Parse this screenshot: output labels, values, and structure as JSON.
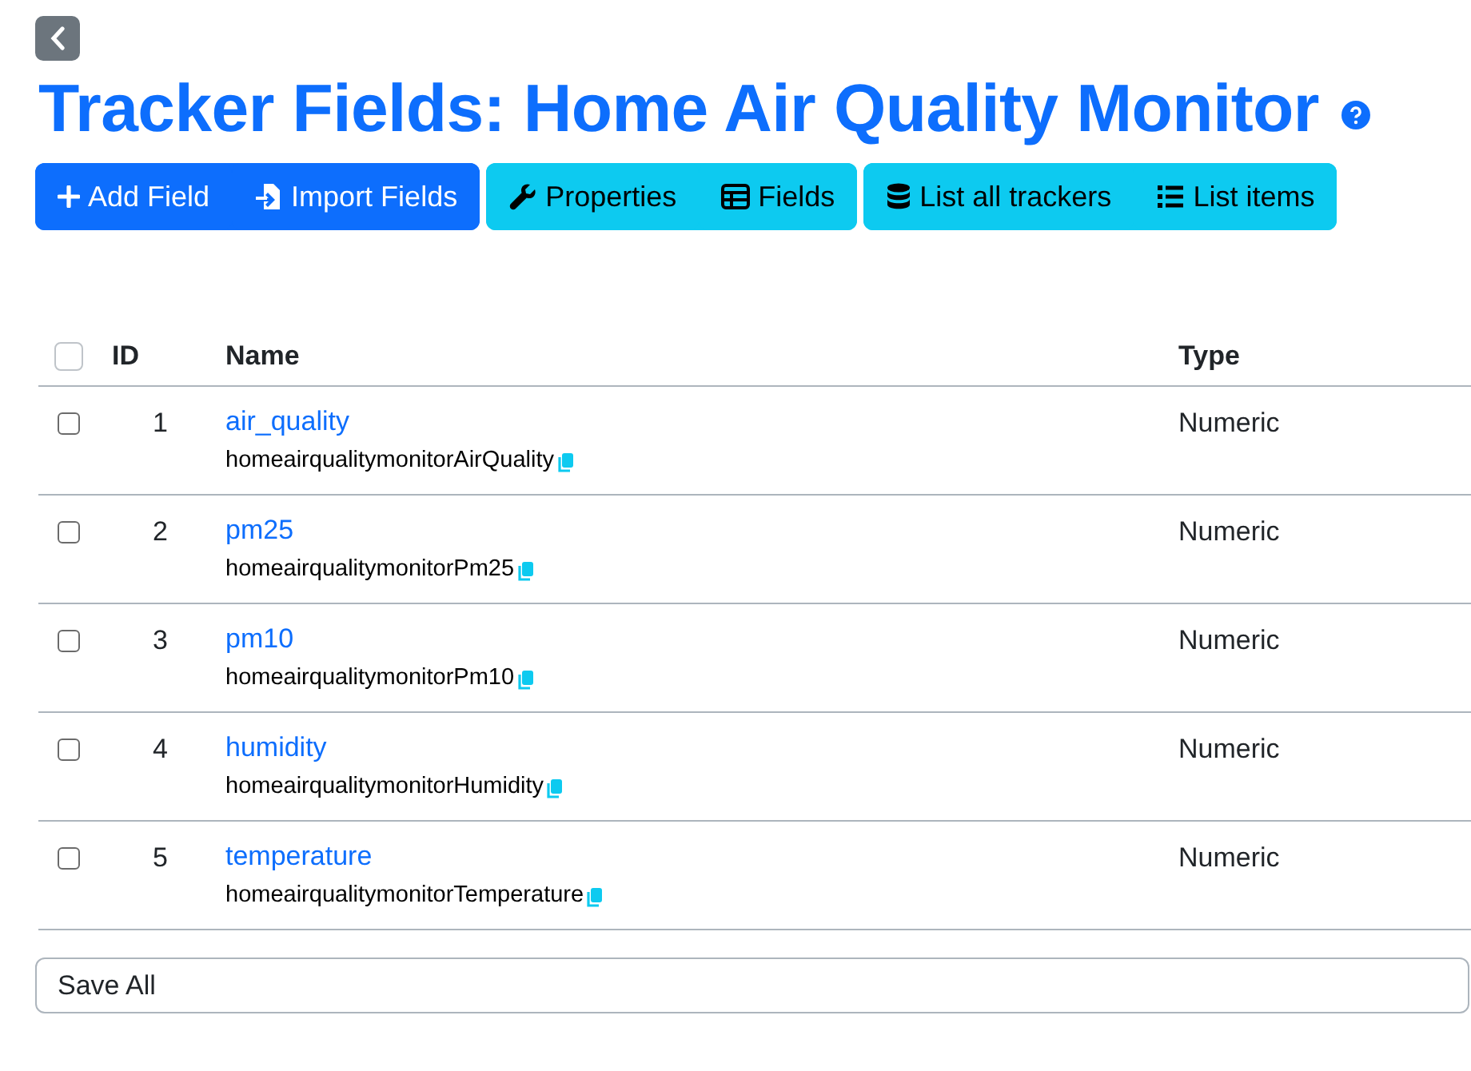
{
  "title": "Tracker Fields: Home Air Quality Monitor",
  "button_groups": [
    {
      "kind": "primary",
      "buttons": [
        "Add Field",
        "Import Fields"
      ]
    },
    {
      "kind": "info",
      "buttons": [
        "Properties",
        "Fields"
      ]
    },
    {
      "kind": "info",
      "buttons": [
        "List all trackers",
        "List items"
      ]
    }
  ],
  "table": {
    "select_all": {
      "checked": false
    },
    "columns": [
      "ID",
      "Name",
      "Type"
    ],
    "rows": [
      {
        "checked": false,
        "id": "1",
        "name": "air_quality",
        "key": "homeairqualitymonitorAirQuality",
        "type": "Numeric"
      },
      {
        "checked": false,
        "id": "2",
        "name": "pm25",
        "key": "homeairqualitymonitorPm25",
        "type": "Numeric"
      },
      {
        "checked": false,
        "id": "3",
        "name": "pm10",
        "key": "homeairqualitymonitorPm10",
        "type": "Numeric"
      },
      {
        "checked": false,
        "id": "4",
        "name": "humidity",
        "key": "homeairqualitymonitorHumidity",
        "type": "Numeric"
      },
      {
        "checked": false,
        "id": "5",
        "name": "temperature",
        "key": "homeairqualitymonitorTemperature",
        "type": "Numeric"
      }
    ]
  },
  "save_all": "Save All"
}
